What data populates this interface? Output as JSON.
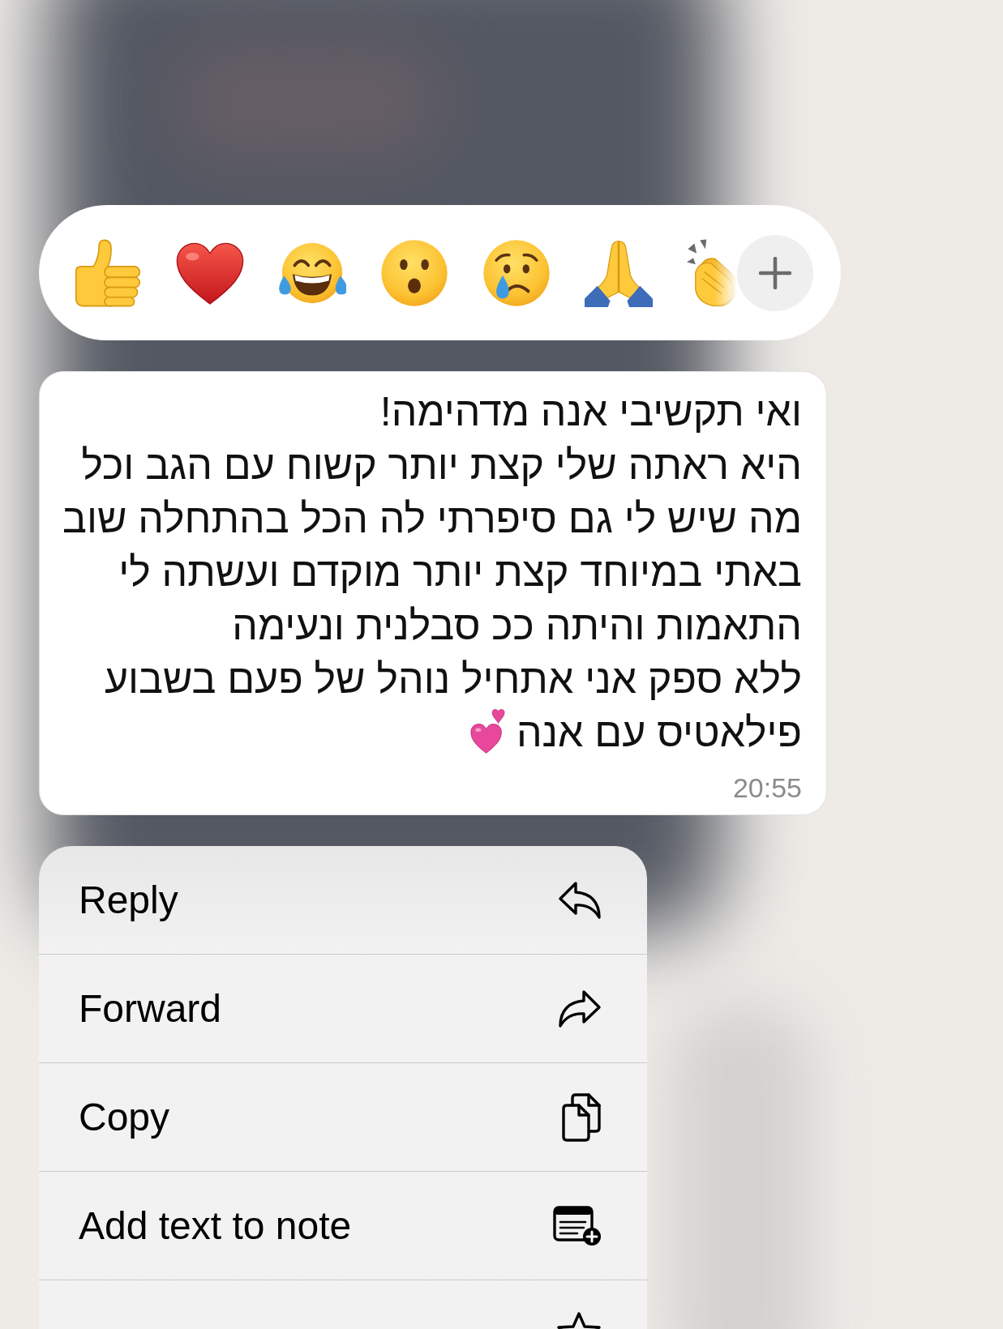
{
  "reaction_bar": {
    "reactions": [
      {
        "kind": "thumbs_up"
      },
      {
        "kind": "heart"
      },
      {
        "kind": "tears_of_joy"
      },
      {
        "kind": "hushed"
      },
      {
        "kind": "crying"
      },
      {
        "kind": "praying_hands"
      },
      {
        "kind": "clapping_hands"
      }
    ]
  },
  "message": {
    "lines": [
      "ואי תקשיבי אנה מדהימה!",
      "היא ראתה שלי קצת יותר קשוח עם הגב וכל",
      "מה שיש לי גם סיפרתי לה הכל בהתחלה שוב",
      "באתי במיוחד קצת יותר מוקדם ועשתה לי",
      "התאמות והיתה ככ סבלנית ונעימה",
      "ללא ספק אני אתחיל נוהל של פעם בשבוע",
      "פילאטיס עם אנה"
    ],
    "emoji": {
      "kind": "two_hearts"
    },
    "time": "20:55"
  },
  "menu": {
    "items": [
      {
        "label": "Reply",
        "kind": "reply"
      },
      {
        "label": "Forward",
        "kind": "forward"
      },
      {
        "label": "Copy",
        "kind": "copy"
      },
      {
        "label": "Add text to note",
        "kind": "add_to_note"
      },
      {
        "kind": "star"
      }
    ]
  }
}
